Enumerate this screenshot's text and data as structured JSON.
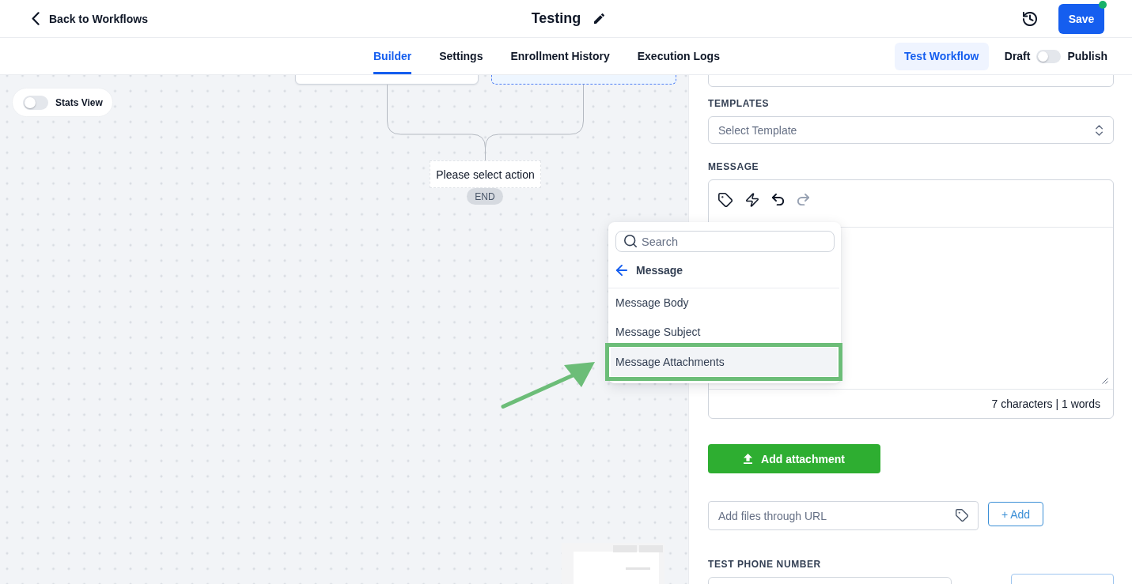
{
  "header": {
    "back_link": "Back to Workflows",
    "title": "Testing",
    "save_button": "Save"
  },
  "tabs": [
    {
      "label": "Builder",
      "selected": true
    },
    {
      "label": "Settings",
      "selected": false
    },
    {
      "label": "Enrollment History",
      "selected": false
    },
    {
      "label": "Execution Logs",
      "selected": false
    }
  ],
  "toolbar": {
    "test_button": "Test Workflow",
    "draft_label": "Draft",
    "publish_label": "Publish",
    "published": false
  },
  "canvas": {
    "stats_view": {
      "label": "Stats View",
      "on": false
    },
    "action_placeholder": "Please select action",
    "end_label": "END"
  },
  "picker": {
    "search_placeholder": "Search",
    "back_label": "Message",
    "items": [
      {
        "label": "Message Body",
        "selected": false
      },
      {
        "label": "Message Subject",
        "selected": false
      },
      {
        "label": "Message Attachments",
        "selected": true
      }
    ]
  },
  "panel": {
    "templates": {
      "label": "TEMPLATES",
      "placeholder": "Select Template"
    },
    "message": {
      "label": "MESSAGE",
      "undo": {
        "disabled": false
      },
      "redo": {
        "disabled": true
      },
      "counter": "7 characters | 1 words"
    },
    "attachment_button": "Add attachment",
    "url_field": {
      "placeholder": "Add files through URL"
    },
    "url_add_button": "+ Add",
    "test_phone": {
      "label": "TEST PHONE NUMBER"
    }
  }
}
